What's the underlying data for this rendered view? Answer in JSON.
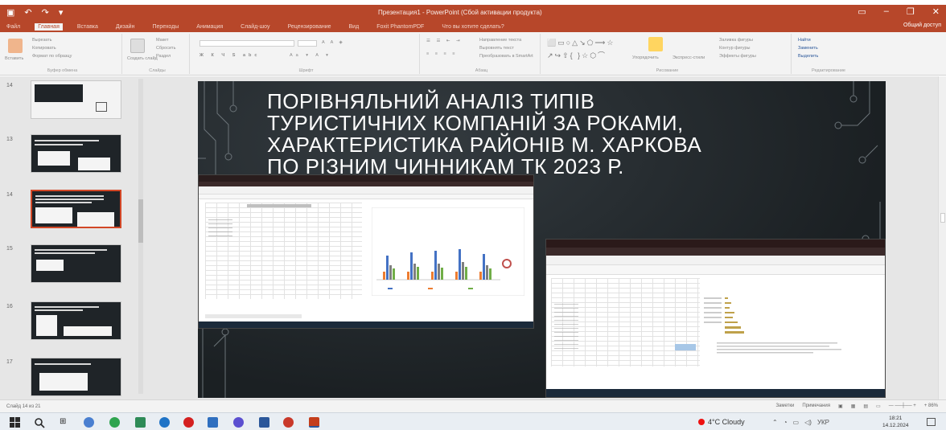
{
  "window": {
    "title": "Презентация1 - PowerPoint (Сбой активации продукта)",
    "share_label": "Общий доступ"
  },
  "ribbon": {
    "tabs": [
      "Файл",
      "Главная",
      "Вставка",
      "Дизайн",
      "Переходы",
      "Анимация",
      "Слайд-шоу",
      "Рецензирование",
      "Вид",
      "Foxit PhantomPDF",
      "Что вы хотите сделать?"
    ],
    "active_tab": "Главная",
    "groups": {
      "clipboard": {
        "paste": "Вставить",
        "cut": "Вырезать",
        "copy": "Копировать",
        "format": "Формат по образцу",
        "caption": "Буфер обмена"
      },
      "slides": {
        "new": "Создать слайд",
        "layout": "Макет",
        "reset": "Сбросить",
        "section": "Раздел",
        "caption": "Слайды"
      },
      "font": {
        "caption": "Шрифт"
      },
      "paragraph": {
        "direction": "Направление текста",
        "align": "Выровнять текст",
        "smartart": "Преобразовать в SmartArt",
        "caption": "Абзац"
      },
      "drawing": {
        "arrange": "Упорядочить",
        "styles": "Экспресс-стили",
        "fill": "Заливка фигуры",
        "outline": "Контур фигуры",
        "effects": "Эффекты фигуры",
        "caption": "Рисование"
      },
      "editing": {
        "find": "Найти",
        "replace": "Заменить",
        "select": "Выделить",
        "caption": "Редактирование"
      }
    }
  },
  "thumbnails": [
    {
      "num": "14"
    },
    {
      "num": "13"
    },
    {
      "num": "14",
      "selected": true
    },
    {
      "num": "15"
    },
    {
      "num": "16"
    },
    {
      "num": "17"
    }
  ],
  "slide": {
    "title_lines": [
      "ПОРІВНЯЛЬНИЙ АНАЛІЗ ТИПІВ",
      "ТУРИСТИЧНИХ КОМПАНІЙ ЗА РОКАМИ,",
      "ХАРАКТЕРИСТИКА РАЙОНІВ М. ХАРКОВА",
      "ПО РІЗНИМ ЧИННИКАМ ТК 2023 Р."
    ],
    "embedded_shots": [
      {
        "kind": "excel-with-bar-chart"
      },
      {
        "kind": "excel-with-horizontal-bar-chart"
      }
    ]
  },
  "status_bar": {
    "left": "Слайд 14 из 21",
    "right": [
      "Заметки",
      "Примечания"
    ],
    "zoom": "+ 86% "
  },
  "taskbar": {
    "weather": "4°C Cloudy",
    "time": "18:21",
    "date": "14.12.2024"
  },
  "colors": {
    "accent": "#b7472a",
    "slide_bg": "#1b2023",
    "chart_blue": "#4472c4",
    "chart_orange": "#ed7d31",
    "chart_green": "#70ad47"
  }
}
